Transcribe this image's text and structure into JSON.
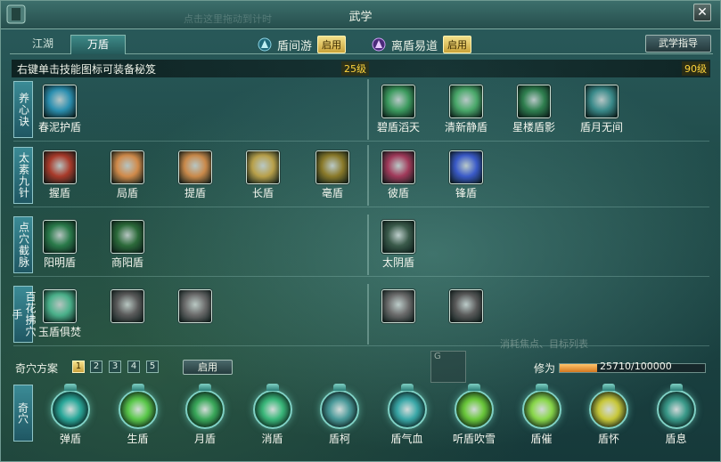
{
  "window": {
    "title": "武学",
    "ghost_text": "点击这里拖动到计时",
    "close_glyph": "✕"
  },
  "tabs": [
    {
      "label": "江湖",
      "active": false
    },
    {
      "label": "万盾",
      "active": true
    }
  ],
  "shield_modes": [
    {
      "label": "盾间游",
      "button": "启用",
      "icon": "blue-shield-icon"
    },
    {
      "label": "离盾易道",
      "button": "启用",
      "icon": "purple-shield-icon"
    }
  ],
  "guide_button": "武学指导",
  "hint": {
    "text": "右键单击技能图标可装备秘笈",
    "level_left": "25级",
    "level_right": "90级"
  },
  "rows": [
    {
      "label": "养心诀",
      "left": [
        {
          "name": "春泥护盾",
          "icon": "blue-rune-icon",
          "color": "#2b8fb0"
        }
      ],
      "right": [
        {
          "name": "碧盾滔天",
          "icon": "green-wave-icon",
          "color": "#3c9a5e"
        },
        {
          "name": "清新静盾",
          "icon": "green-mandala-icon",
          "color": "#4aa86a"
        },
        {
          "name": "星楼盾影",
          "icon": "green-burst-icon",
          "color": "#2f7f4f"
        },
        {
          "name": "盾月无间",
          "icon": "figure-icon",
          "color": "#3a8a8a"
        }
      ]
    },
    {
      "label": "太素九针",
      "left": [
        {
          "name": "握盾",
          "icon": "red-blade-icon",
          "color": "#a83a2a"
        },
        {
          "name": "局盾",
          "icon": "palm-icon",
          "color": "#d08a4a"
        },
        {
          "name": "提盾",
          "icon": "palm-glow-icon",
          "color": "#c9894a"
        },
        {
          "name": "长盾",
          "icon": "fist-icon",
          "color": "#b8a04a"
        },
        {
          "name": "亳盾",
          "icon": "gold-streak-icon",
          "color": "#8a7a2a"
        }
      ],
      "right": [
        {
          "name": "彼盾",
          "icon": "claw-icon",
          "color": "#a03a5a"
        },
        {
          "name": "锋盾",
          "icon": "blue-slash-icon",
          "color": "#3a5ac8"
        }
      ]
    },
    {
      "label": "点穴截脉",
      "left": [
        {
          "name": "阳明盾",
          "icon": "taiji-icon",
          "color": "#2a7a4a"
        },
        {
          "name": "商阳盾",
          "icon": "dragon-icon",
          "color": "#2c6a3a"
        }
      ],
      "right": [
        {
          "name": "太阴盾",
          "icon": "shadow-figure-icon",
          "color": "#3a5a4a"
        }
      ]
    },
    {
      "label": "百花拂穴手",
      "left": [
        {
          "name": "玉盾俱焚",
          "icon": "jade-ring-icon",
          "color": "#4ab08a"
        },
        {
          "name": "",
          "icon": "gray-swirl-icon",
          "color": "#5a5a5a"
        },
        {
          "name": "",
          "icon": "gray-cloud-icon",
          "color": "#6a6a6a"
        }
      ],
      "right": [
        {
          "name": "",
          "icon": "gray-hand-icon",
          "color": "#6a6a6a"
        },
        {
          "name": "",
          "icon": "gray-burst-icon",
          "color": "#5a5a5a"
        }
      ]
    }
  ],
  "plan": {
    "label": "奇穴方案",
    "numbers": [
      "1",
      "2",
      "3",
      "4",
      "5"
    ],
    "active_index": 0,
    "enable": "启用"
  },
  "xiuwei": {
    "label": "修为",
    "value_text": "25710/100000",
    "fraction": 0.2571
  },
  "ghost_slot_letter": "G",
  "ghost_hint": "消耗焦点、目标列表",
  "qixue": {
    "label": "奇穴",
    "items": [
      {
        "name": "弹盾",
        "icon": "teal-swirl-icon",
        "color": "#2aa89a"
      },
      {
        "name": "生盾",
        "icon": "green-light-icon",
        "color": "#5ac84a"
      },
      {
        "name": "月盾",
        "icon": "clover-icon",
        "color": "#3aa85a"
      },
      {
        "name": "消盾",
        "icon": "green-flame-icon",
        "color": "#3ab87a"
      },
      {
        "name": "盾柯",
        "icon": "teal-sprite-icon",
        "color": "#4a9a9a"
      },
      {
        "name": "盾气血",
        "icon": "tree-icon",
        "color": "#3aa8a8"
      },
      {
        "name": "听盾吹雪",
        "icon": "green-beast-icon",
        "color": "#6ac83a"
      },
      {
        "name": "盾催",
        "icon": "leaf-icon",
        "color": "#8ad84a"
      },
      {
        "name": "盾怀",
        "icon": "orb-icon",
        "color": "#c8c83a"
      },
      {
        "name": "盾息",
        "icon": "sage-icon",
        "color": "#3a9a8a"
      }
    ]
  }
}
